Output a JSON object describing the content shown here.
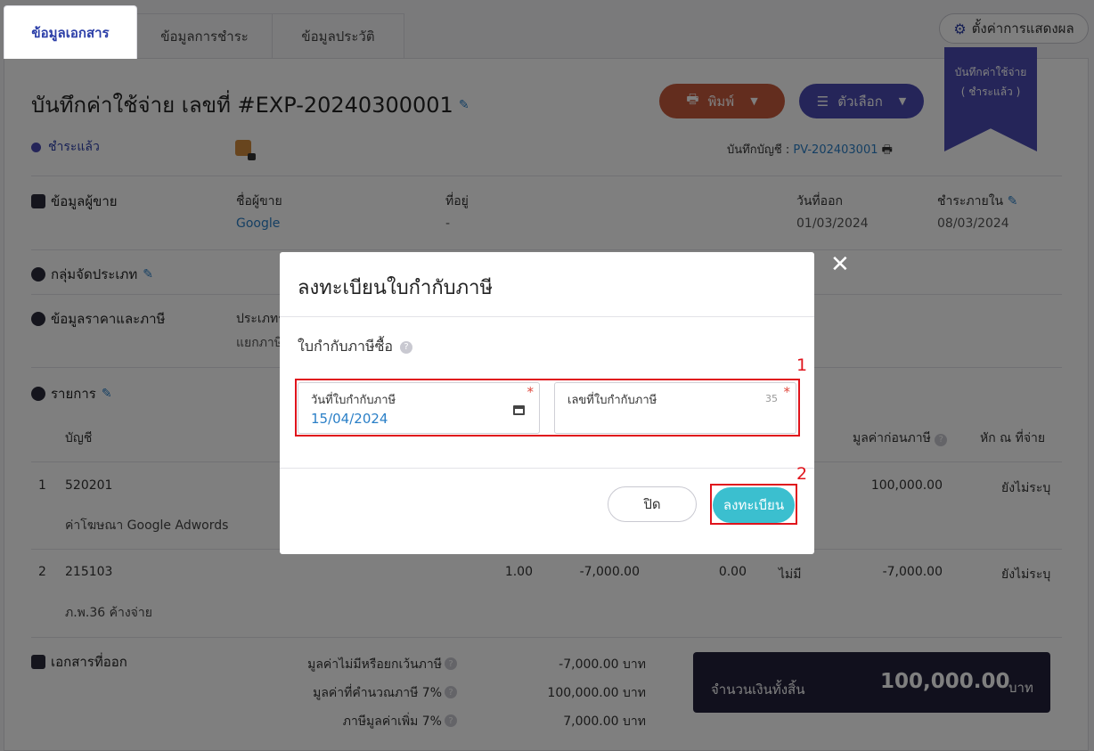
{
  "tabs": [
    "ข้อมูลเอกสาร",
    "ข้อมูลการชำระ",
    "ข้อมูลประวัติ"
  ],
  "settings_label": "ตั้งค่าการแสดงผล",
  "doc_title": "บันทึกค่าใช้จ่าย เลขที่ #EXP-20240300001",
  "buttons": {
    "print": "พิมพ์",
    "options": "ตัวเลือก"
  },
  "ribbon": {
    "line1": "บันทึกค่าใช้จ่าย",
    "line2": "( ชำระแล้ว )"
  },
  "status": "ชำระแล้ว",
  "account": {
    "label": "บันทึกบัญชี :",
    "value": "PV-202403001"
  },
  "vendor": {
    "heading": "ข้อมูลผู้ขาย",
    "name_label": "ชื่อผู้ขาย",
    "name": "Google",
    "address_label": "ที่อยู่",
    "address": "-",
    "issue_label": "วันที่ออก",
    "issue_date": "01/03/2024",
    "due_label": "ชำระภายใน",
    "due_date": "08/03/2024"
  },
  "category_heading": "กลุ่มจัดประเภท",
  "pricing": {
    "heading": "ข้อมูลราคาและภาษี",
    "type_label": "ประเภทร",
    "type_value": "แยกภาษี"
  },
  "items": {
    "heading": "รายการ",
    "col_account": "บัญชี",
    "col_pretax": "มูลค่าก่อนภาษี",
    "col_wht": "หัก ณ ที่จ่าย",
    "rows": [
      {
        "no": "1",
        "account": "520201",
        "desc": "ค่าโฆษณา Google Adwords",
        "pretax": "100,000.00",
        "wht": "ยังไม่ระบุ"
      },
      {
        "no": "2",
        "account": "215103",
        "desc": "ภ.พ.36 ค้างจ่าย",
        "qty": "1.00",
        "price": "-7,000.00",
        "discount": "0.00",
        "vat": "ไม่มี",
        "pretax": "-7,000.00",
        "wht": "ยังไม่ระบุ"
      }
    ]
  },
  "issued_docs_heading": "เอกสารที่ออก",
  "summary": [
    {
      "label": "มูลค่าไม่มีหรือยกเว้นภาษี",
      "value": "-7,000.00 บาท"
    },
    {
      "label": "มูลค่าที่คำนวณภาษี 7%",
      "value": "100,000.00 บาท"
    },
    {
      "label": "ภาษีมูลค่าเพิ่ม 7%",
      "value": "7,000.00 บาท"
    }
  ],
  "total": {
    "label": "จำนวนเงินทั้งสิ้น",
    "value": "100,000.00",
    "unit": "บาท"
  },
  "modal": {
    "title": "ลงทะเบียนใบกำกับภาษี",
    "subtitle": "ใบกำกับภาษีซื้อ",
    "date_label": "วันที่ใบกำกับภาษี",
    "date_value": "15/04/2024",
    "number_label": "เลขที่ใบกำกับภาษี",
    "number_counter": "35",
    "required_mark": "*",
    "close_label": "ปิด",
    "register_label": "ลงทะเบียน",
    "marker1": "1",
    "marker2": "2"
  },
  "colors": {
    "primary": "#4a4ab3",
    "print": "#c65a3d",
    "register": "#3bbfcf",
    "highlight": "#e0141c",
    "total_bg": "#22213b"
  }
}
